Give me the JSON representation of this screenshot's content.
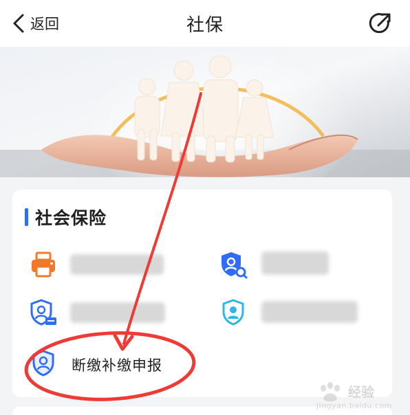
{
  "header": {
    "back_label": "返回",
    "title": "社保"
  },
  "section": {
    "title": "社会保险"
  },
  "services": [
    {
      "icon": "printer-icon",
      "label": ""
    },
    {
      "icon": "shield-user-search-icon",
      "label": ""
    },
    {
      "icon": "shield-user-card-icon",
      "label": ""
    },
    {
      "icon": "shield-user-icon",
      "label": ""
    },
    {
      "icon": "shield-user-icon",
      "label": "断缴补缴申报"
    }
  ],
  "watermark": {
    "brand": "经验",
    "url": "jingyan.baidu.com"
  },
  "colors": {
    "accent_blue": "#2f6df6",
    "printer_orange": "#f07a2a",
    "cyan": "#2bb7e8",
    "annotation_red": "#ee3b36"
  }
}
